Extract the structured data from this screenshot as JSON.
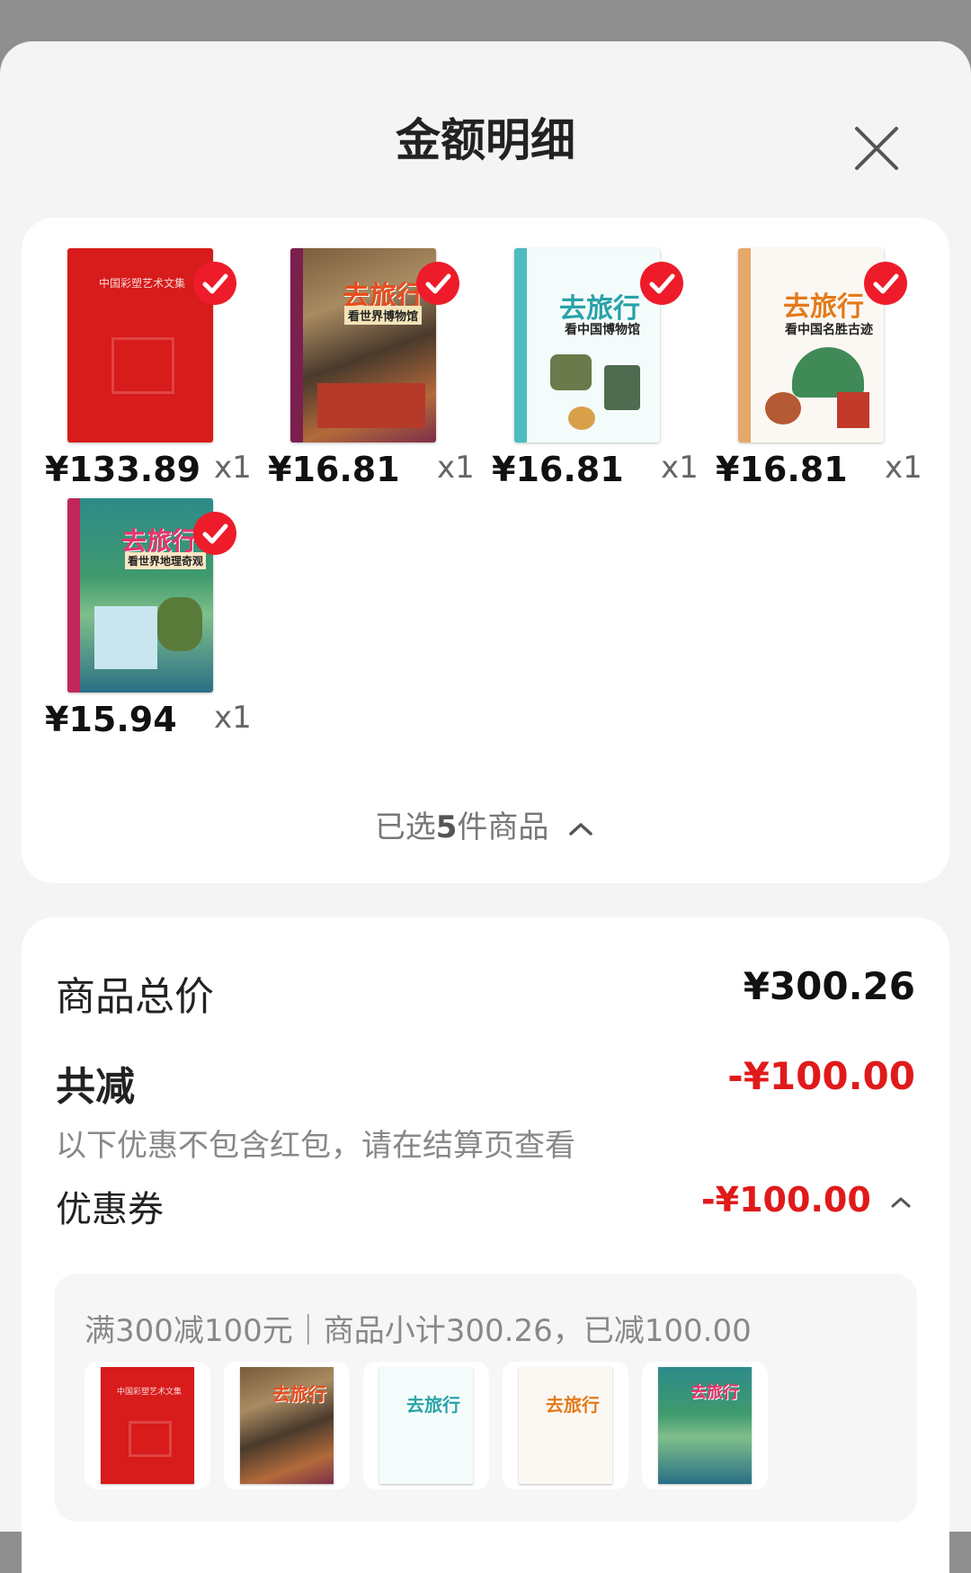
{
  "header": {
    "title": "金额明细"
  },
  "icons": {
    "close": "close-icon",
    "check": "check-icon",
    "chevron": "chevron-up-icon"
  },
  "colors": {
    "accent": "#ee1c2a",
    "discount": "#e01a1a"
  },
  "products": [
    {
      "price": "¥133.89",
      "qty": "x1",
      "cover_title": "中国彩塑艺术文集"
    },
    {
      "price": "¥16.81",
      "qty": "x1",
      "cover_title": "去旅行",
      "cover_sub": "看世界博物馆"
    },
    {
      "price": "¥16.81",
      "qty": "x1",
      "cover_title": "去旅行",
      "cover_sub": "看中国博物馆"
    },
    {
      "price": "¥16.81",
      "qty": "x1",
      "cover_title": "去旅行",
      "cover_sub": "看中国名胜古迹"
    },
    {
      "price": "¥15.94",
      "qty": "x1",
      "cover_title": "去旅行",
      "cover_sub": "看世界地理奇观"
    }
  ],
  "selection": {
    "prefix": "已选",
    "count": "5",
    "suffix": "件商品"
  },
  "summary": {
    "total_label": "商品总价",
    "total_value": "¥300.26",
    "discount_label": "共减",
    "discount_value": "-¥100.00",
    "discount_note": "以下优惠不包含红包，请在结算页查看",
    "coupon_label": "优惠券",
    "coupon_value": "-¥100.00",
    "coupon_detail": "满300减100元｜商品小计300.26，已减100.00"
  }
}
